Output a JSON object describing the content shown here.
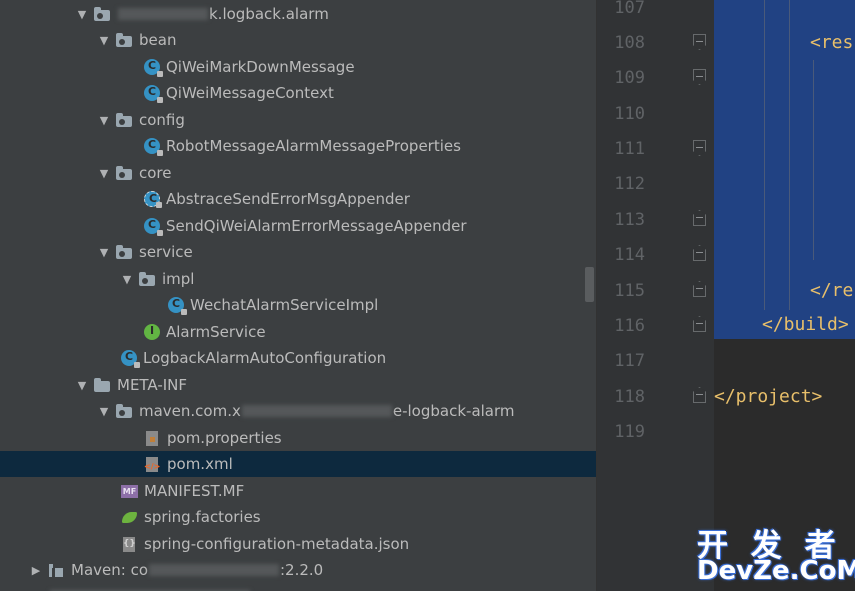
{
  "tree": {
    "rows": [
      {
        "label": "k.logback.alarm",
        "icon": "package-icon",
        "arrow": "▼"
      },
      {
        "label": "bean",
        "icon": "package-icon",
        "arrow": "▼"
      },
      {
        "label": "QiWeiMarkDownMessage",
        "icon": "class-icon"
      },
      {
        "label": "QiWeiMessageContext",
        "icon": "class-icon"
      },
      {
        "label": "config",
        "icon": "package-icon",
        "arrow": "▼"
      },
      {
        "label": "RobotMessageAlarmMessageProperties",
        "icon": "class-icon"
      },
      {
        "label": "core",
        "icon": "package-icon",
        "arrow": "▼"
      },
      {
        "label": "AbstraceSendErrorMsgAppender",
        "icon": "abstract-class-icon"
      },
      {
        "label": "SendQiWeiAlarmErrorMessageAppender",
        "icon": "class-icon"
      },
      {
        "label": "service",
        "icon": "package-icon",
        "arrow": "▼"
      },
      {
        "label": "impl",
        "icon": "package-icon",
        "arrow": "▼"
      },
      {
        "label": "WechatAlarmServiceImpl",
        "icon": "class-icon"
      },
      {
        "label": "AlarmService",
        "icon": "interface-icon"
      },
      {
        "label": "LogbackAlarmAutoConfiguration",
        "icon": "class-icon"
      },
      {
        "label": "META-INF",
        "icon": "folder-icon",
        "arrow": "▼"
      },
      {
        "label": "maven.com.x",
        "label_end": "e-logback-alarm",
        "icon": "package-icon",
        "arrow": "▼"
      },
      {
        "label": "pom.properties",
        "icon": "properties-file-icon"
      },
      {
        "label": "pom.xml",
        "icon": "xml-file-icon",
        "selected": true
      },
      {
        "label": "MANIFEST.MF",
        "icon": "manifest-file-icon"
      },
      {
        "label": "spring.factories",
        "icon": "spring-icon"
      },
      {
        "label": "spring-configuration-metadata.json",
        "icon": "json-file-icon"
      },
      {
        "label": "Maven: co",
        "label_end": ":2.2.0",
        "icon": "maven-library-icon",
        "arrow": "▶"
      }
    ]
  },
  "editor": {
    "line_numbers": [
      "107",
      "108",
      "109",
      "110",
      "111",
      "112",
      "113",
      "114",
      "115",
      "116",
      "117",
      "118",
      "119"
    ],
    "code": {
      "line108": "<res",
      "line115": "</re",
      "line116": "</build>",
      "line118": "</project>"
    }
  },
  "watermark": {
    "line1": "开 发 者",
    "line2": "DevZe.CoM"
  }
}
